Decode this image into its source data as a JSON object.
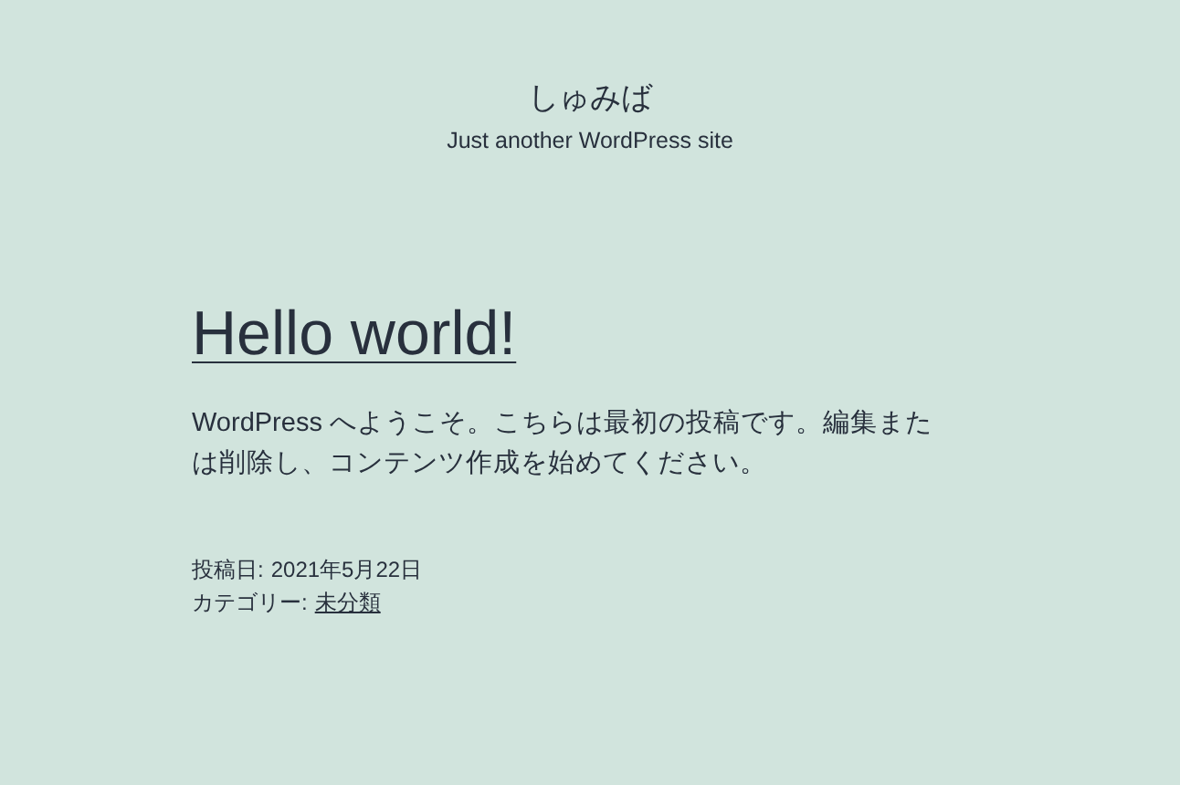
{
  "site": {
    "title": "しゅみば",
    "tagline": "Just another WordPress site"
  },
  "post": {
    "title": "Hello world!",
    "body": "WordPress へようこそ。こちらは最初の投稿です。編集または削除し、コンテンツ作成を始めてください。",
    "meta": {
      "date_label": "投稿日:",
      "date": "2021年5月22日",
      "category_label": "カテゴリー:",
      "category": "未分類"
    }
  }
}
